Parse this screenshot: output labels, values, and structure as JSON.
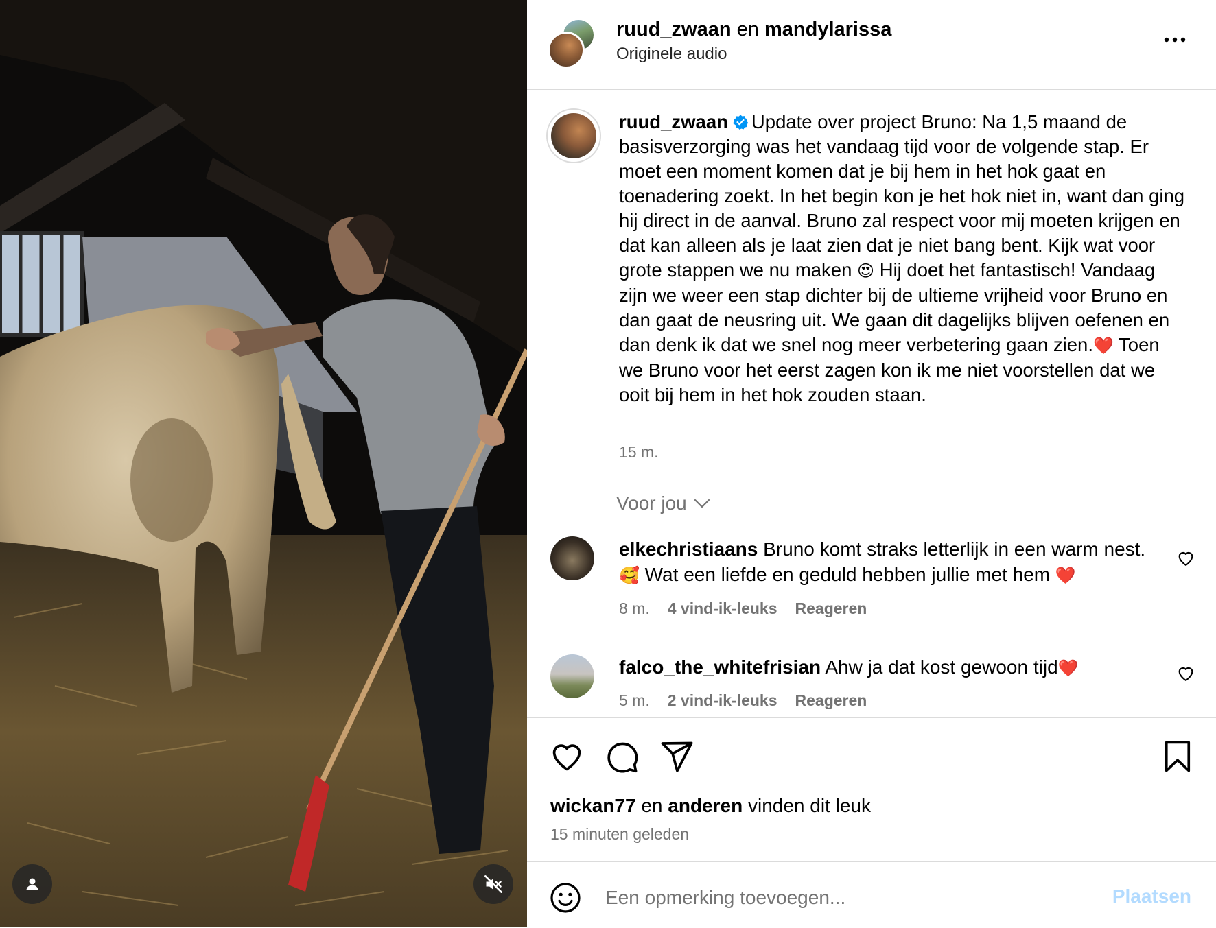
{
  "header": {
    "user1": "ruud_zwaan",
    "joiner": "en",
    "user2": "mandylarissa",
    "audio": "Originele audio"
  },
  "caption": {
    "username": "ruud_zwaan",
    "text_part1": "Update over project Bruno: Na 1,5 maand de basisverzorging was het vandaag tijd voor de volgende stap. Er moet een moment komen dat je bij hem in het hok gaat en toenadering zoekt. In het begin kon je het hok niet in, want dan ging hij direct in de aanval. Bruno zal respect voor mij moeten krijgen en dat kan alleen als je laat zien dat je niet bang bent. Kijk wat voor grote stappen we nu maken ",
    "emoji1": "😍",
    "text_part2": " Hij doet het fantastisch! Vandaag zijn we weer een stap dichter bij de ultieme vrijheid voor Bruno en dan gaat de neusring uit. We gaan dit dagelijks blijven oefenen en dan denk ik dat we snel nog meer verbetering gaan zien.",
    "emoji2": "❤️",
    "text_part3": " Toen we Bruno voor het eerst zagen kon ik me niet voorstellen dat we ooit bij hem in het hok zouden staan.",
    "time": "15 m."
  },
  "for_you": "Voor jou",
  "comments": [
    {
      "username": "elkechristiaans",
      "text": "Bruno komt straks letterlijk in een warm nest. ",
      "emoji_a": "🥰",
      "text_b": " Wat een liefde en geduld hebben jullie met hem ",
      "emoji_b": "❤️",
      "time": "8 m.",
      "likes": "4 vind-ik-leuks",
      "reply": "Reageren"
    },
    {
      "username": "falco_the_whitefrisian",
      "text": "Ahw ja dat kost gewoon tijd",
      "emoji_a": "❤️",
      "time": "5 m.",
      "likes": "2 vind-ik-leuks",
      "reply": "Reageren"
    }
  ],
  "likes": {
    "user": "wickan77",
    "joiner": "en",
    "others": "anderen",
    "suffix": "vinden dit leuk"
  },
  "posted": "15 minuten geleden",
  "add_comment": {
    "placeholder": "Een opmerking toevoegen...",
    "post": "Plaatsen"
  },
  "colors": {
    "link_disabled": "#b3dbff",
    "secondary_text": "#737373",
    "border": "#dbdbdb",
    "verified": "#0095f6",
    "heart": "#e0243b"
  },
  "icons": [
    "more-icon",
    "verified-icon",
    "chevron-down-icon",
    "heart-icon",
    "comment-icon",
    "share-icon",
    "bookmark-icon",
    "emoji-icon",
    "user-tag-icon",
    "muted-icon"
  ]
}
